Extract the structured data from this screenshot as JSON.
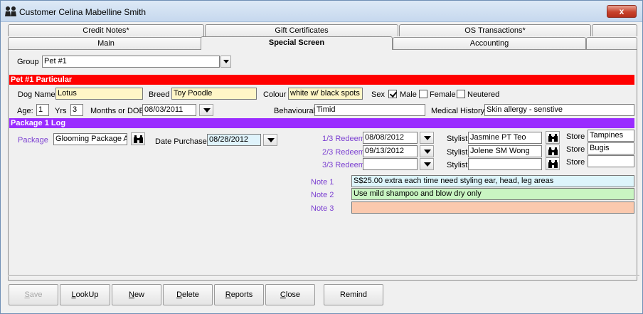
{
  "window": {
    "title": "Customer Celina Mabelline Smith",
    "close_label": "x"
  },
  "tabs_back": [
    "Credit Notes*",
    "Gift Certificates",
    "OS Transactions*"
  ],
  "tabs_front": [
    {
      "label": "Main",
      "active": false
    },
    {
      "label": "Special Screen",
      "active": true
    },
    {
      "label": "Accounting",
      "active": false
    }
  ],
  "group": {
    "label": "Group",
    "value": "Pet #1"
  },
  "pet": {
    "header": "Pet  #1  Particular",
    "dog_name_label": "Dog Name",
    "dog_name": "Lotus",
    "breed_label": "Breed",
    "breed": "Toy Poodle",
    "colour_label": "Colour",
    "colour": "white w/ black spots",
    "sex_label": "Sex",
    "male_label": "Male",
    "male_checked": true,
    "female_label": "Female",
    "female_checked": false,
    "neutered_label": "Neutered",
    "neutered_checked": false,
    "age_label": "Age:",
    "age_years": "1",
    "yrs_label": "Yrs",
    "age_months": "3",
    "dob_label": "Months or DOB",
    "dob": "08/03/2011",
    "behavioural_label": "Behavioural",
    "behavioural": "Timid",
    "medical_label": "Medical History",
    "medical": "Skin allergy - senstive"
  },
  "package": {
    "header": "Package 1 Log",
    "package_label": "Package",
    "package": "Glooming Package A",
    "purchased_label": "Date Purchased",
    "purchased": "08/28/2012",
    "redeems": [
      {
        "label": "1/3 Redeem",
        "date": "08/08/2012",
        "stylist_label": "Stylist",
        "stylist": "Jasmine PT Teo",
        "store_label": "Store",
        "store": "Tampines"
      },
      {
        "label": "2/3 Redeem",
        "date": "09/13/2012",
        "stylist_label": "Stylist",
        "stylist": "Jolene SM Wong",
        "store_label": "Store",
        "store": "Bugis"
      },
      {
        "label": "3/3 Redeem",
        "date": "",
        "stylist_label": "Stylist",
        "stylist": "",
        "store_label": "Store",
        "store": ""
      }
    ],
    "notes": [
      {
        "label": "Note 1",
        "value": "S$25.00 extra each time need styling ear, head, leg areas"
      },
      {
        "label": "Note 2",
        "value": "Use mild shampoo and blow dry only"
      },
      {
        "label": "Note 3",
        "value": ""
      }
    ]
  },
  "buttons": [
    {
      "label": "Save",
      "ul": "S",
      "rest": "ave",
      "enabled": false
    },
    {
      "label": "LookUp",
      "ul": "L",
      "rest": "ookUp",
      "enabled": true
    },
    {
      "label": "New",
      "ul": "N",
      "rest": "ew",
      "enabled": true
    },
    {
      "label": "Delete",
      "ul": "D",
      "rest": "elete",
      "enabled": true
    },
    {
      "label": "Reports",
      "ul": "R",
      "rest": "eports",
      "enabled": true
    },
    {
      "label": "Close",
      "ul": "C",
      "rest": "lose",
      "enabled": true
    },
    {
      "label": "Remind",
      "ul": "",
      "rest": "Remind",
      "enabled": true
    }
  ]
}
